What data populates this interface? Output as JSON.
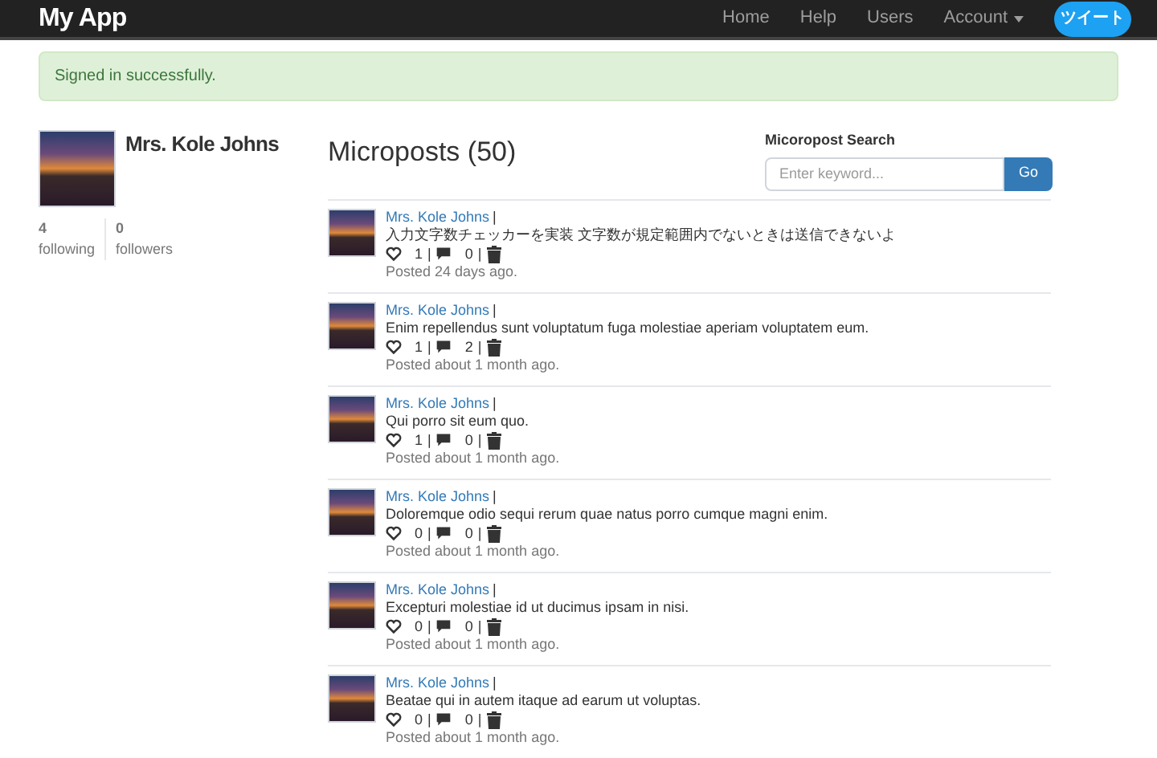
{
  "navbar": {
    "brand": "My App",
    "links": [
      {
        "label": "Home",
        "kind": "link"
      },
      {
        "label": "Help",
        "kind": "link"
      },
      {
        "label": "Users",
        "kind": "link"
      },
      {
        "label": "Account",
        "kind": "dropdown"
      }
    ],
    "tweet_button": "ツイート"
  },
  "flash": "Signed in successfully.",
  "profile": {
    "name": "Mrs. Kole Johns",
    "stats": [
      {
        "count": "4",
        "label": "following"
      },
      {
        "count": "0",
        "label": "followers"
      }
    ]
  },
  "microposts": {
    "title": "Microposts (50)",
    "search": {
      "label": "Micoropost Search",
      "placeholder": "Enter keyword...",
      "button": "Go"
    },
    "posts": [
      {
        "author": "Mrs. Kole Johns",
        "author_sep": "|",
        "content": "入力文字数チェッカーを実装 文字数が規定範囲内でないときは送信できないよ",
        "likes": "1",
        "likes_sep": "|",
        "comments": "0",
        "comments_sep": "|",
        "time": "Posted 24 days ago."
      },
      {
        "author": "Mrs. Kole Johns",
        "author_sep": "|",
        "content": "Enim repellendus sunt voluptatum fuga molestiae aperiam voluptatem eum.",
        "likes": "1",
        "likes_sep": "|",
        "comments": "2",
        "comments_sep": "|",
        "time": "Posted about 1 month ago."
      },
      {
        "author": "Mrs. Kole Johns",
        "author_sep": "|",
        "content": "Qui porro sit eum quo.",
        "likes": "1",
        "likes_sep": "|",
        "comments": "0",
        "comments_sep": "|",
        "time": "Posted about 1 month ago."
      },
      {
        "author": "Mrs. Kole Johns",
        "author_sep": "|",
        "content": "Doloremque odio sequi rerum quae natus porro cumque magni enim.",
        "likes": "0",
        "likes_sep": "|",
        "comments": "0",
        "comments_sep": "|",
        "time": "Posted about 1 month ago."
      },
      {
        "author": "Mrs. Kole Johns",
        "author_sep": "|",
        "content": "Excepturi molestiae id ut ducimus ipsam in nisi.",
        "likes": "0",
        "likes_sep": "|",
        "comments": "0",
        "comments_sep": "|",
        "time": "Posted about 1 month ago."
      },
      {
        "author": "Mrs. Kole Johns",
        "author_sep": "|",
        "content": "Beatae qui in autem itaque ad earum ut voluptas.",
        "likes": "0",
        "likes_sep": "|",
        "comments": "0",
        "comments_sep": "|",
        "time": "Posted about 1 month ago."
      }
    ]
  }
}
